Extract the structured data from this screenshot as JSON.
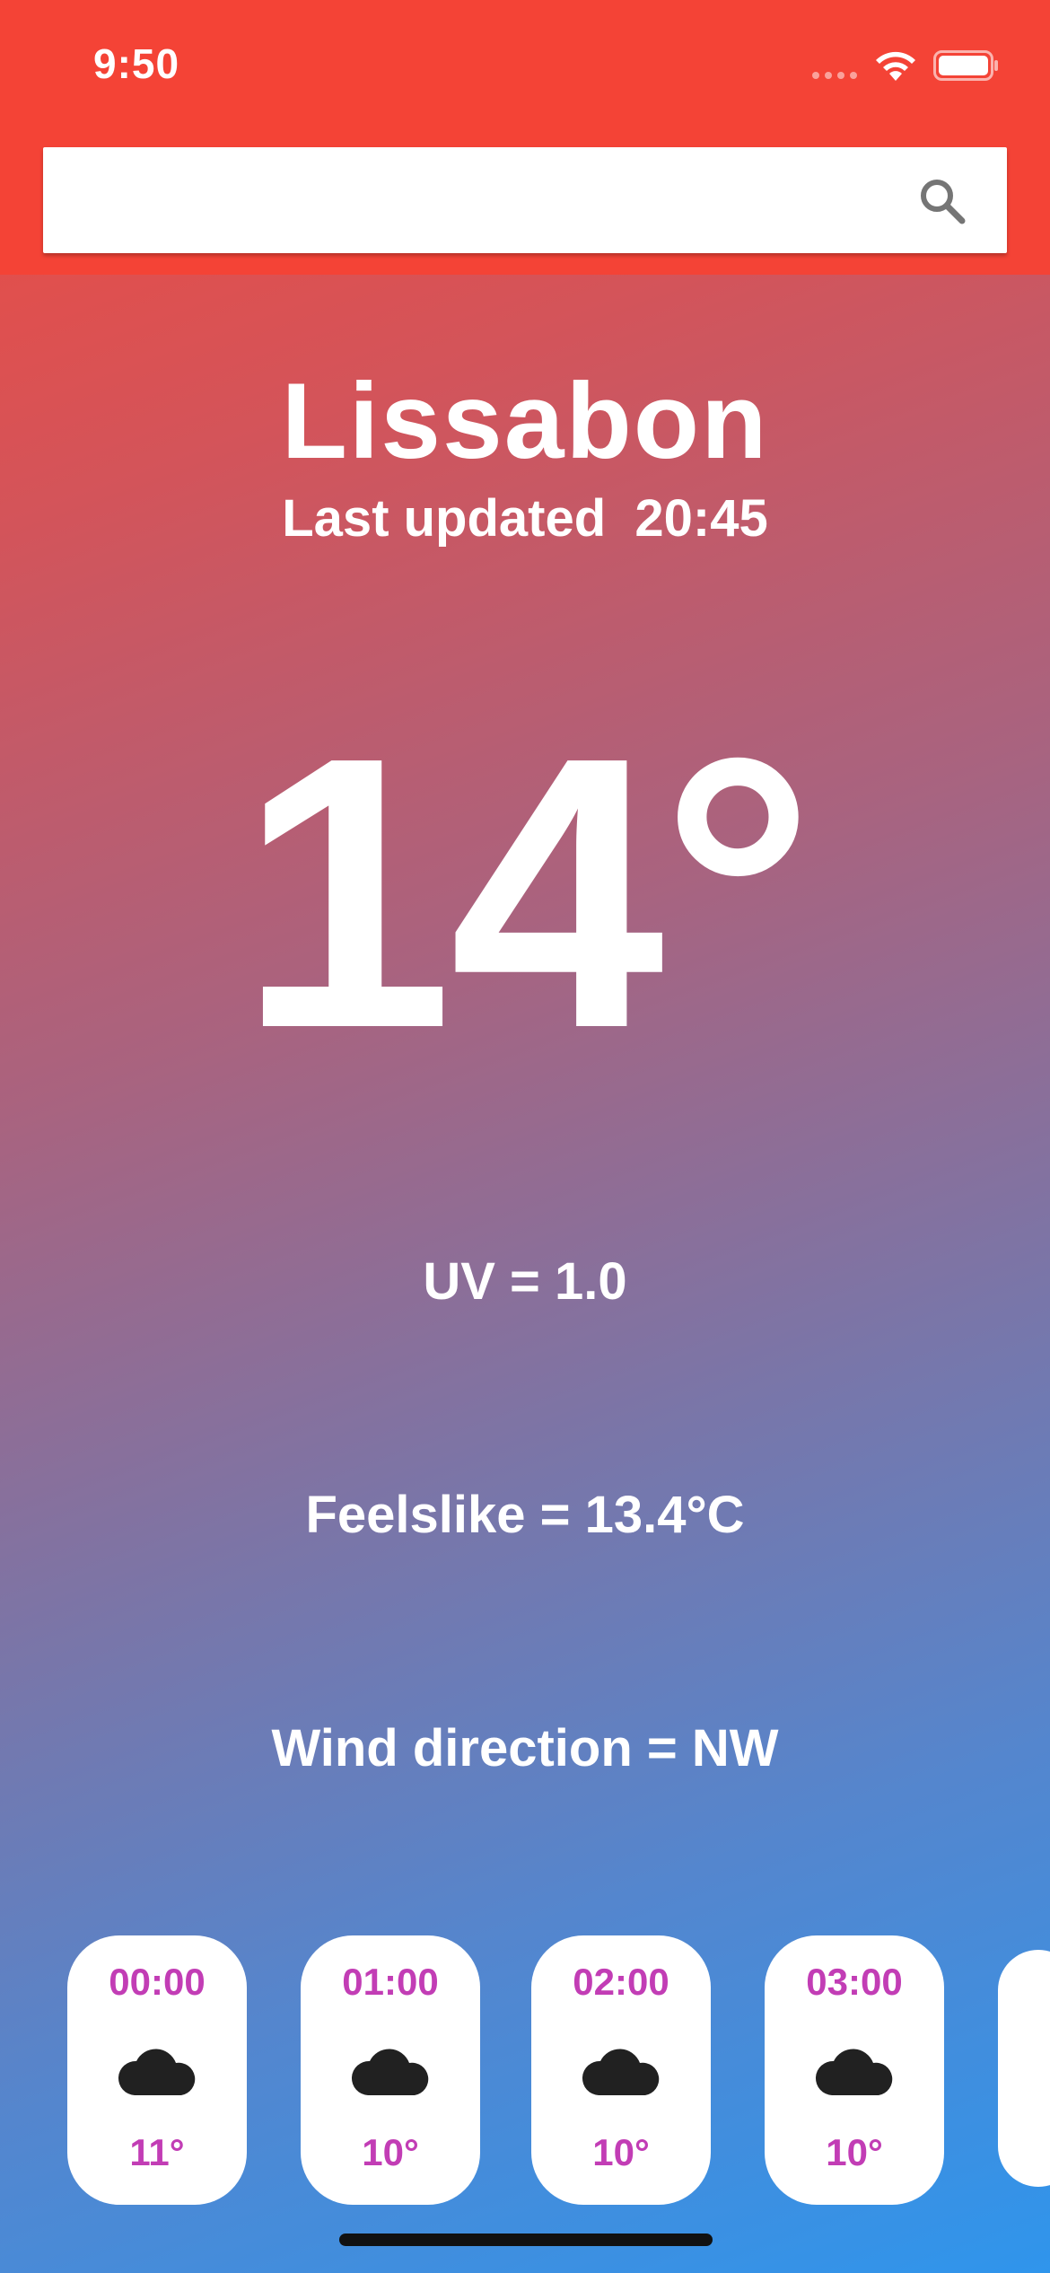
{
  "status_bar": {
    "time": "9:50"
  },
  "search": {
    "value": "",
    "placeholder": ""
  },
  "weather": {
    "city": "Lissabon",
    "last_updated": "Last updated  20:45",
    "temperature": "14°",
    "uv": "UV = 1.0",
    "feelslike": "Feelslike = 13.4°C",
    "wind_direction": "Wind direction = NW"
  },
  "hourly": [
    {
      "time": "00:00",
      "icon": "cloud-icon",
      "temp": "11°"
    },
    {
      "time": "01:00",
      "icon": "cloud-icon",
      "temp": "10°"
    },
    {
      "time": "02:00",
      "icon": "cloud-icon",
      "temp": "10°"
    },
    {
      "time": "03:00",
      "icon": "cloud-icon",
      "temp": "10°"
    }
  ],
  "colors": {
    "header_red": "#f44336",
    "gradient_top": "#f04a3e",
    "gradient_bottom": "#2f95ec",
    "hour_text": "#c23db5"
  }
}
